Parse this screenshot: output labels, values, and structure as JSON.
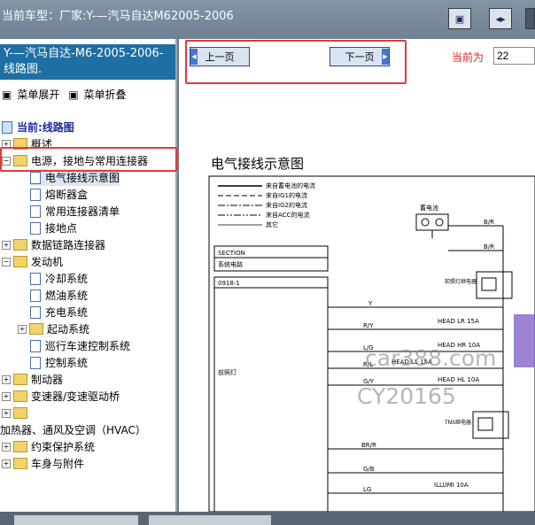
{
  "titlebar": {
    "title": "当前车型：厂家:Y-—汽马自达M62005-2006"
  },
  "sidebar": {
    "header": "Y-—汽马自达-M6-2005-2006-线路图.",
    "expand_label": "菜单展开",
    "collapse_label": "菜单折叠",
    "current_label": "当前:线路图",
    "items": [
      {
        "label": "概述"
      },
      {
        "label": "电源，接地与常用连接器"
      },
      {
        "label": "电气接线示意图"
      },
      {
        "label": "熔断器盒"
      },
      {
        "label": "常用连接器清单"
      },
      {
        "label": "接地点"
      },
      {
        "label": "数据链路连接器"
      },
      {
        "label": "发动机"
      },
      {
        "label": "冷却系统"
      },
      {
        "label": "燃油系统"
      },
      {
        "label": "充电系统"
      },
      {
        "label": "起动系统"
      },
      {
        "label": "巡行车速控制系统"
      },
      {
        "label": "控制系统"
      },
      {
        "label": "制动器"
      },
      {
        "label": "变速器/变速驱动桥"
      },
      {
        "label": ""
      },
      {
        "label": "加热器、通风及空调（HVAC）"
      },
      {
        "label": "约束保护系统"
      },
      {
        "label": "车身与附件"
      }
    ]
  },
  "nav": {
    "prev_label": "上一页",
    "next_label": "下一页",
    "current_page_label": "当前为",
    "current_page_value": "22"
  },
  "diagram": {
    "title": "电气接线示意图",
    "legend": [
      "来自蓄电池的电流",
      "来自IG1的电流",
      "来自IG2的电流",
      "来自ACC的电流",
      "其它"
    ],
    "section_label": "SECTION",
    "section_value": "系统电路",
    "code": "0918-1",
    "circuit_name": "前照灯",
    "battery_label": "蓄电池",
    "wire_br": "B/R",
    "relay_label_1": "前照灯继电器",
    "relay_label_2": "TNS继电器",
    "wires": [
      "Y",
      "R/Y",
      "L/G",
      "R/L",
      "G/Y",
      "BR/R",
      "G/B",
      "LG"
    ],
    "fuses": [
      "HEAD LR 15A",
      "HEAD HR 10A",
      "HEAD LL 15A",
      "HEAD HL 10A",
      "ILLUMI 10A"
    ]
  },
  "watermark": {
    "line1": "car388.com",
    "line2": "CY20165"
  }
}
